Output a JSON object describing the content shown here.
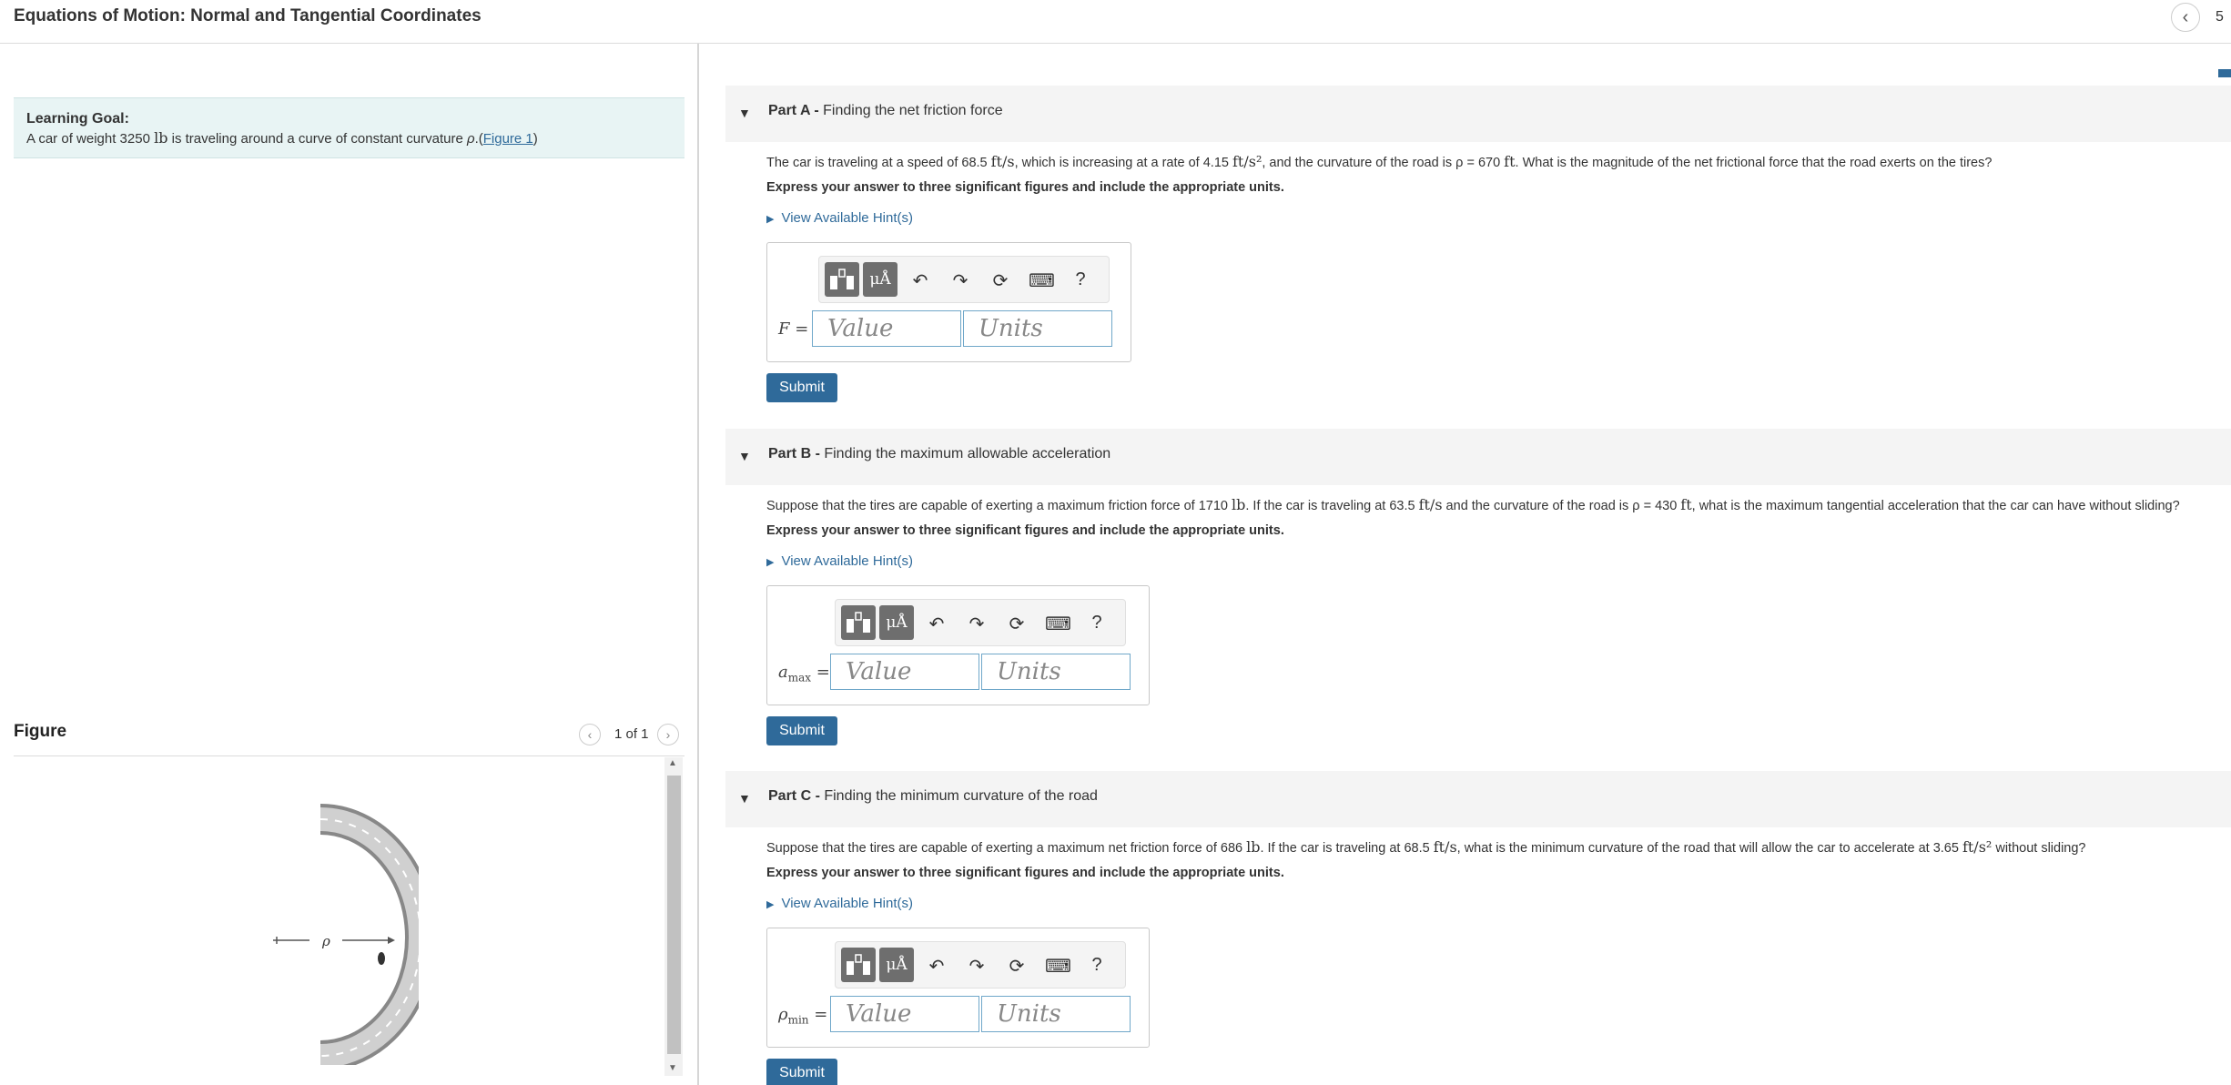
{
  "header": {
    "title": "Equations of Motion: Normal and Tangential Coordinates",
    "nav_prev_icon": "chevron-left-icon",
    "count_partial": "5"
  },
  "learning_goal": {
    "label": "Learning Goal:",
    "text_pre": "A car of weight 3250 ",
    "unit": "lb",
    "text_post": " is traveling around a curve of constant curvature ",
    "rho": "ρ",
    "link_open": ".(",
    "link": "Figure 1",
    "link_close": ")"
  },
  "figure": {
    "title": "Figure",
    "count": "1 of 1",
    "rho_label": "ρ"
  },
  "toolbar": {
    "templates_icon": "templates-icon",
    "units_label": "μÅ",
    "undo_icon": "undo-icon",
    "redo_icon": "redo-icon",
    "reset_icon": "reset-icon",
    "keyboard_icon": "keyboard-icon",
    "help_label": "?"
  },
  "parts": [
    {
      "part_label": "Part A - ",
      "part_title": "Finding the net friction force",
      "q1": "The car is traveling at a speed of 68.5 ",
      "u1": "ft/s",
      "q2": ", which is increasing at a rate of 4.15 ",
      "u2": "ft/s²",
      "q3": ", and the curvature of the road is ρ = 670 ",
      "u3": "ft",
      "q4": ". What is the magnitude of the net frictional force that the road exerts on the tires?",
      "express": "Express your answer to three significant figures and include the appropriate units.",
      "hint": "View Available Hint(s)",
      "var": "F",
      "var_sub": "",
      "value_placeholder": "Value",
      "units_placeholder": "Units",
      "submit": "Submit"
    },
    {
      "part_label": "Part B - ",
      "part_title": "Finding the maximum allowable acceleration",
      "q1": "Suppose that the tires are capable of exerting a maximum friction force of 1710 ",
      "u1": "lb",
      "q2": ". If the car is traveling at 63.5 ",
      "u2": "ft/s",
      "q3": " and the curvature of the road is ρ = 430 ",
      "u3": "ft",
      "q4": ", what is the maximum tangential acceleration that the car can have without sliding?",
      "express": "Express your answer to three significant figures and include the appropriate units.",
      "hint": "View Available Hint(s)",
      "var": "a",
      "var_sub": "max",
      "value_placeholder": "Value",
      "units_placeholder": "Units",
      "submit": "Submit"
    },
    {
      "part_label": "Part C - ",
      "part_title": "Finding the minimum curvature of the road",
      "q1": "Suppose that the tires are capable of exerting a maximum net friction force of 686 ",
      "u1": "lb",
      "q2": ". If the car is traveling at 68.5 ",
      "u2": "ft/s",
      "q3": ", what is the minimum curvature of the road that will allow the car to accelerate at 3.65 ",
      "u3": "ft/s²",
      "q4": " without sliding?",
      "express": "Express your answer to three significant figures and include the appropriate units.",
      "hint": "View Available Hint(s)",
      "var": "ρ",
      "var_sub": "min",
      "value_placeholder": "Value",
      "units_placeholder": "Units",
      "submit": "Submit"
    }
  ],
  "equals": "="
}
